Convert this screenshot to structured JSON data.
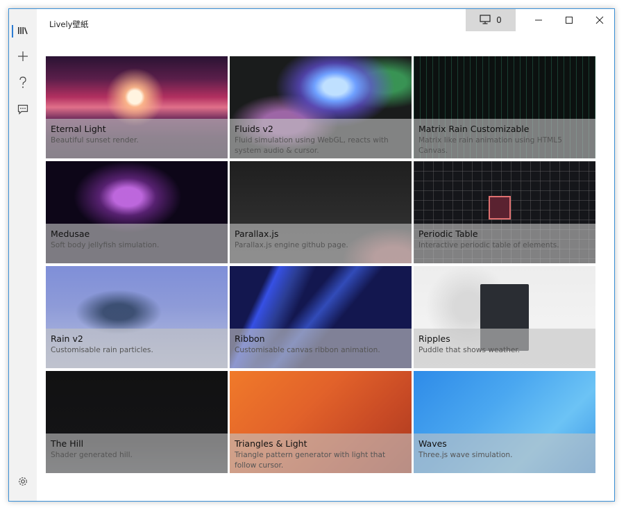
{
  "window": {
    "title": "Lively壁紙",
    "monitor_count": "0",
    "accent": "#2b7bd3"
  },
  "sidebar": {
    "items": [
      {
        "icon": "library-icon",
        "active": true
      },
      {
        "icon": "add-icon"
      },
      {
        "icon": "help-icon"
      },
      {
        "icon": "feedback-icon"
      },
      {
        "icon": "settings-icon"
      }
    ]
  },
  "wallpapers": [
    {
      "name": "Eternal Light",
      "desc": "Beautiful sunset render."
    },
    {
      "name": "Fluids v2",
      "desc": "Fluid simulation using WebGL, reacts with system audio & cursor."
    },
    {
      "name": "Matrix Rain Customizable",
      "desc": "Matrix like rain animation using HTML5 Canvas."
    },
    {
      "name": "Medusae",
      "desc": "Soft body jellyfish simulation."
    },
    {
      "name": "Parallax.js",
      "desc": "Parallax.js engine github page."
    },
    {
      "name": "Periodic Table",
      "desc": "Interactive periodic table of elements."
    },
    {
      "name": "Rain v2",
      "desc": "Customisable rain particles."
    },
    {
      "name": "Ribbon",
      "desc": "Customisable canvas ribbon animation."
    },
    {
      "name": "Ripples",
      "desc": "Puddle that shows weather."
    },
    {
      "name": "The Hill",
      "desc": "Shader generated hill."
    },
    {
      "name": "Triangles & Light",
      "desc": "Triangle pattern generator with light that follow cursor."
    },
    {
      "name": "Waves",
      "desc": "Three.js wave simulation."
    }
  ]
}
